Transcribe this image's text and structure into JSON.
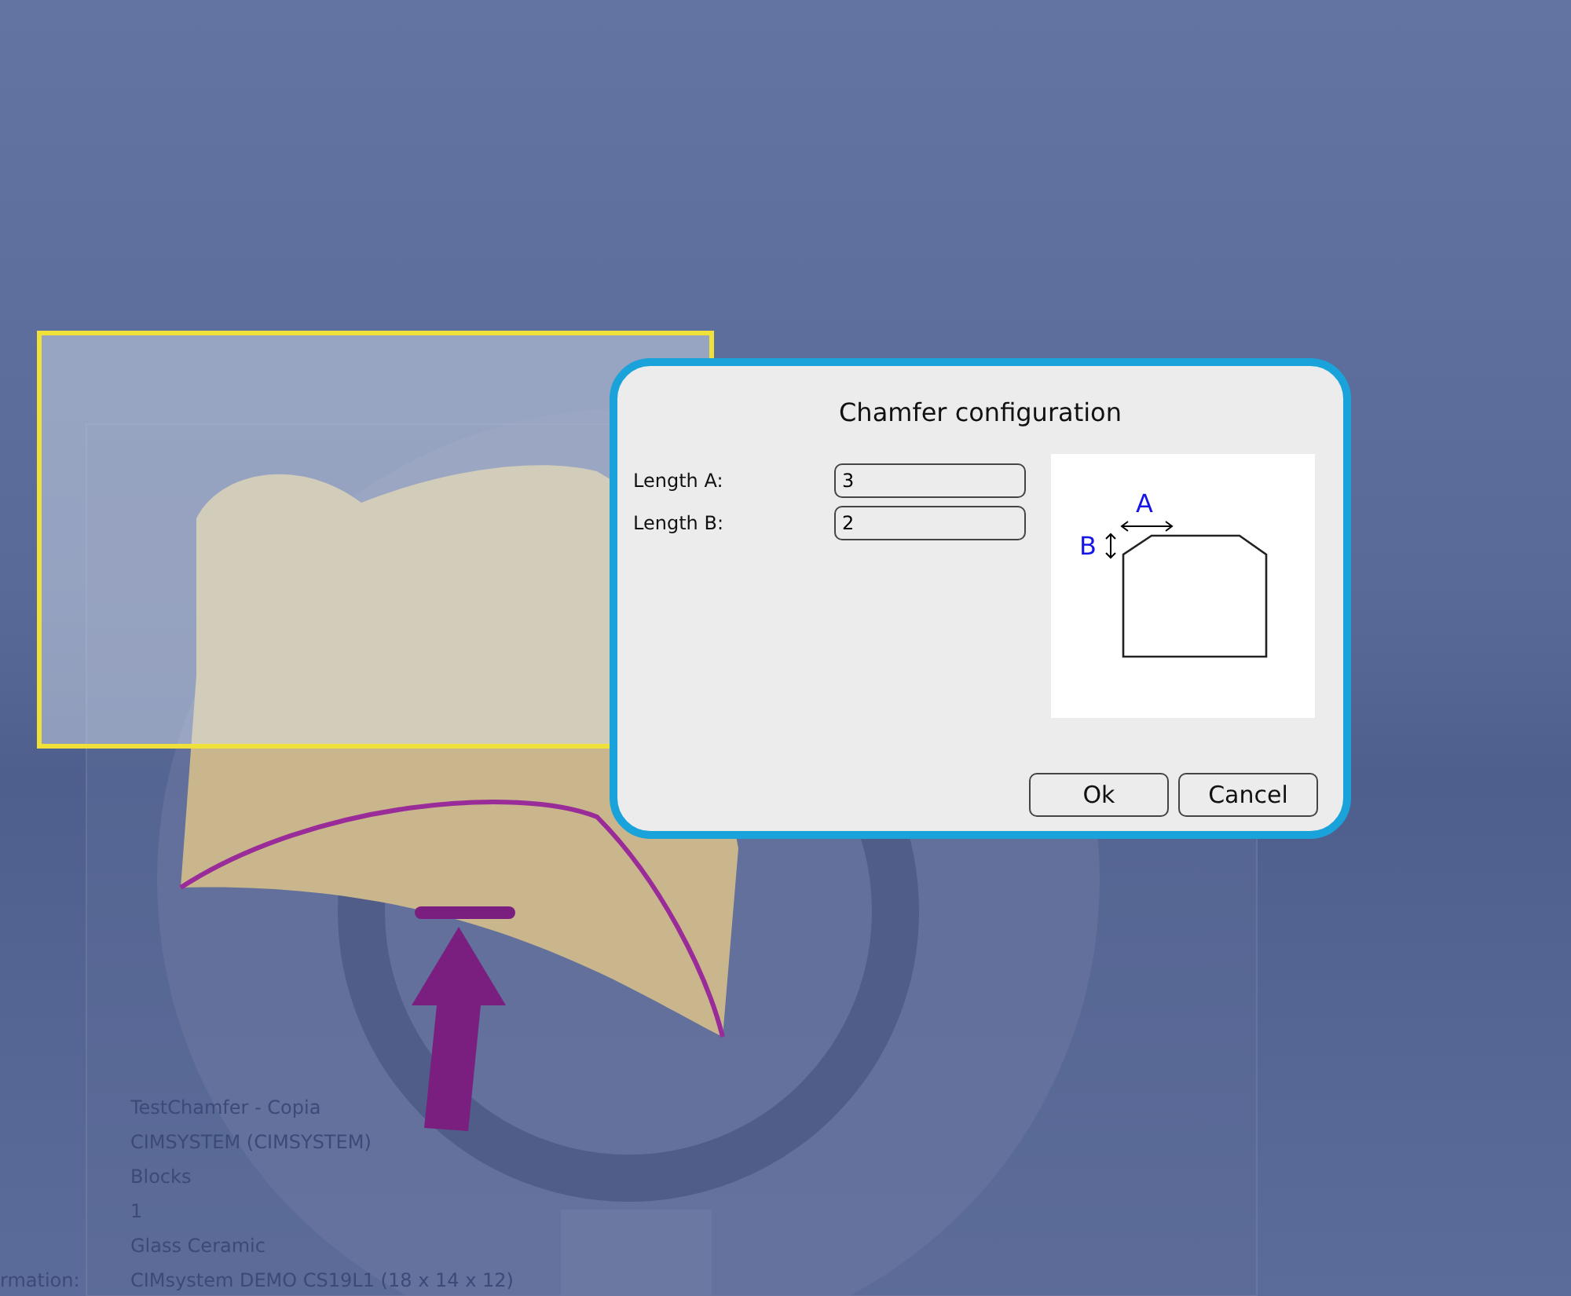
{
  "dialog": {
    "title": "Chamfer configuration",
    "fields": [
      {
        "label": "Length A:",
        "value": "3"
      },
      {
        "label": "Length B:",
        "value": "2"
      }
    ],
    "diagram": {
      "label_a": "A",
      "label_b": "B"
    },
    "buttons": [
      "Ok",
      "Cancel"
    ]
  },
  "info": {
    "cut_label": "rmation:",
    "lines": [
      "TestChamfer - Copia",
      "CIMSYSTEM (CIMSYSTEM)",
      "Blocks",
      "1",
      "Glass Ceramic",
      "CIMsystem DEMO CS19L1 (18 x 14 x 12)"
    ]
  }
}
